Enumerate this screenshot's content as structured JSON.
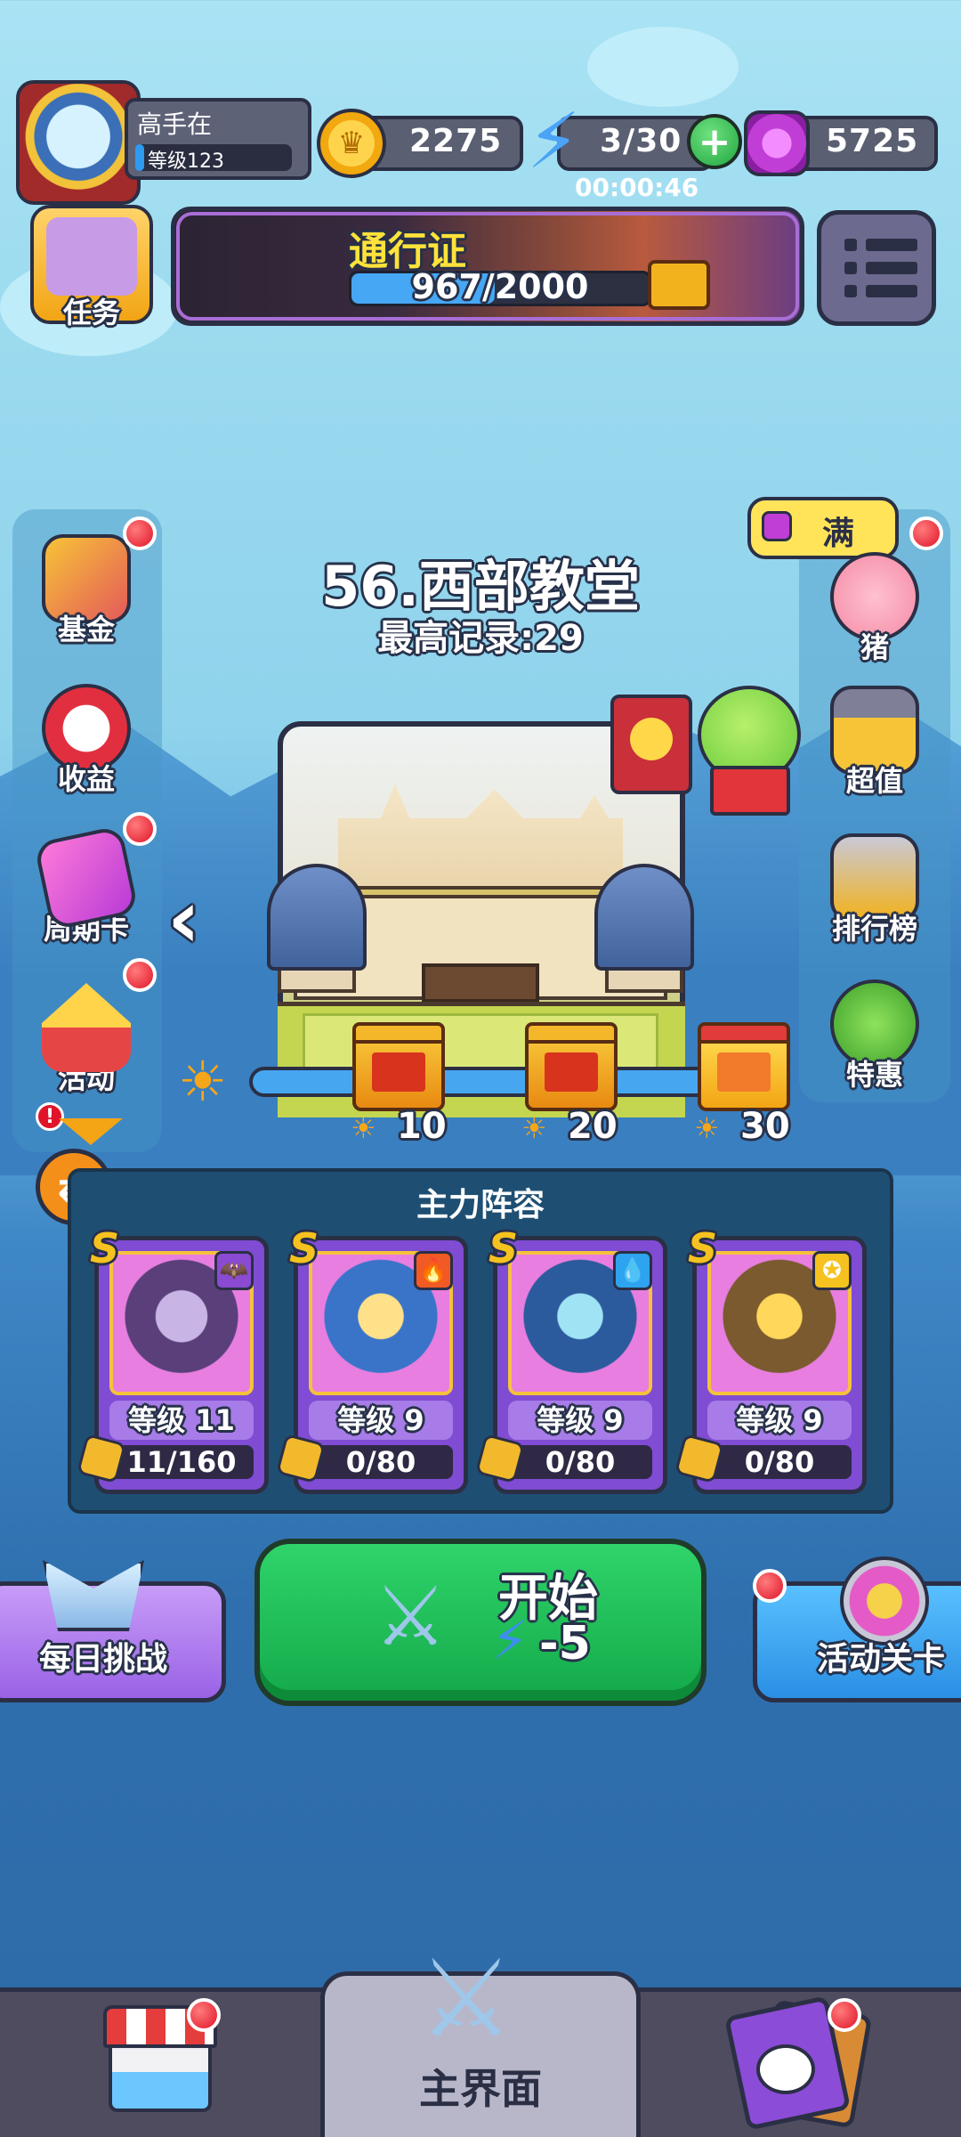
{
  "player": {
    "name": "高手在",
    "level": "等级123"
  },
  "resources": {
    "coins": "2275",
    "energy": "3/30",
    "energy_timer": "00:00:46",
    "gems": "5725"
  },
  "task": {
    "label": "任务"
  },
  "pass": {
    "title": "通行证",
    "progress_text": "967/2000",
    "progress": 0.4835
  },
  "left_menu": [
    {
      "label": "基金",
      "icon": "fund-chart-icon",
      "badge": true
    },
    {
      "label": "收益",
      "icon": "income-timer-icon",
      "badge": false
    },
    {
      "label": "周期卡",
      "icon": "period-card-icon",
      "badge": true
    },
    {
      "label": "活动",
      "icon": "event-tent-icon",
      "badge": true
    }
  ],
  "right_menu": [
    {
      "label": "猪",
      "icon": "piggy-bank-icon",
      "badge": true,
      "bubble": "满"
    },
    {
      "label": "超值",
      "icon": "treasure-chest-icon",
      "badge": false
    },
    {
      "label": "排行榜",
      "icon": "leaderboard-trophy-icon",
      "badge": false
    },
    {
      "label": "特惠",
      "icon": "special-offer-icon",
      "badge": false
    }
  ],
  "stage": {
    "title": "56.西部教堂",
    "record": "最高记录:29"
  },
  "rewards": [
    {
      "value": "10"
    },
    {
      "value": "20"
    },
    {
      "value": "30"
    }
  ],
  "lineup": {
    "title": "主力阵容",
    "heroes": [
      {
        "rank": "S",
        "level": "等级 11",
        "fragments": "11/160",
        "element": "bat-icon",
        "element_color": "#8a4ad1"
      },
      {
        "rank": "S",
        "level": "等级 9",
        "fragments": "0/80",
        "element": "fire-icon",
        "element_color": "#f15a24"
      },
      {
        "rank": "S",
        "level": "等级 9",
        "fragments": "0/80",
        "element": "water-drop-icon",
        "element_color": "#2ea3ef"
      },
      {
        "rank": "S",
        "level": "等级 9",
        "fragments": "0/80",
        "element": "halo-icon",
        "element_color": "#f6c21f"
      }
    ]
  },
  "actions": {
    "daily": "每日挑战",
    "start": "开始",
    "start_cost": "-5",
    "event_stage": "活动关卡"
  },
  "bottom_nav": {
    "main": "主界面"
  },
  "colors": {
    "sky": "#9ad9ee",
    "start_green": "#1bbf55",
    "gold": "#f6c21f",
    "outline": "#2b2f45"
  }
}
